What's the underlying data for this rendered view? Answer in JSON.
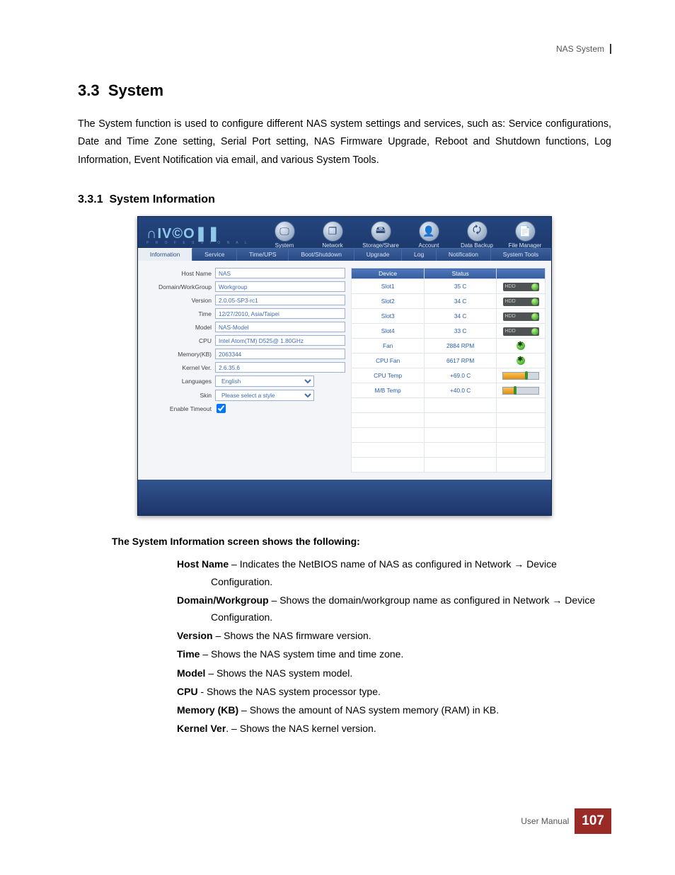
{
  "header": {
    "doc_title": "NAS System"
  },
  "section": {
    "number": "3.3",
    "title": "System"
  },
  "intro": "The System function is used to configure different NAS system settings and services, such as: Service configurations, Date and Time Zone setting, Serial Port setting, NAS Firmware Upgrade, Reboot and Shutdown functions, Log Information, Event Notification via email, and various System Tools.",
  "subsection": {
    "number": "3.3.1",
    "title": "System Information"
  },
  "ui": {
    "logo_main": "∩IV©O❚❚",
    "logo_sub": "P R O F E S S I O N A L",
    "nav_items": [
      {
        "name": "system",
        "label": "System",
        "glyph": "🖵"
      },
      {
        "name": "network",
        "label": "Network",
        "glyph": "❐"
      },
      {
        "name": "storage",
        "label": "Storage/Share",
        "glyph": "🖴"
      },
      {
        "name": "account",
        "label": "Account",
        "glyph": "👤"
      },
      {
        "name": "backup",
        "label": "Data Backup",
        "glyph": "🗘"
      },
      {
        "name": "filemgr",
        "label": "File Manager",
        "glyph": "📄"
      }
    ],
    "tabs": [
      {
        "name": "information",
        "label": "Information",
        "active": true
      },
      {
        "name": "service",
        "label": "Service"
      },
      {
        "name": "timeups",
        "label": "Time/UPS"
      },
      {
        "name": "bootshutdown",
        "label": "Boot/Shutdown"
      },
      {
        "name": "upgrade",
        "label": "Upgrade"
      },
      {
        "name": "log",
        "label": "Log"
      },
      {
        "name": "notification",
        "label": "Notification"
      },
      {
        "name": "systemtools",
        "label": "System Tools"
      }
    ],
    "form": {
      "hostname_label": "Host Name",
      "hostname": "NAS",
      "domain_label": "Domain/WorkGroup",
      "domain": "Workgroup",
      "version_label": "Version",
      "version": "2.0.05-SP3-rc1",
      "time_label": "Time",
      "time": "12/27/2010, Asia/Taipei",
      "model_label": "Model",
      "model": "NAS-Model",
      "cpu_label": "CPU",
      "cpu": "Intel Atom(TM) D525@ 1.80GHz",
      "memory_label": "Memory(KB)",
      "memory": "2063344",
      "kernel_label": "Kernel Ver.",
      "kernel": "2.6.35.6",
      "languages_label": "Languages",
      "languages": "English",
      "skin_label": "Skin",
      "skin": "Please select a style",
      "timeout_label": "Enable Timeout"
    },
    "status": {
      "head_device": "Device",
      "head_status": "Status",
      "head_icon": "",
      "rows": [
        {
          "device": "Slot1",
          "status": "35 C",
          "kind": "hdd",
          "pill": "HDD"
        },
        {
          "device": "Slot2",
          "status": "34 C",
          "kind": "hdd",
          "pill": "HDD"
        },
        {
          "device": "Slot3",
          "status": "34 C",
          "kind": "hdd",
          "pill": "HDD"
        },
        {
          "device": "Slot4",
          "status": "33 C",
          "kind": "hdd",
          "pill": "HDD"
        },
        {
          "device": "Fan",
          "status": "2884 RPM",
          "kind": "fan"
        },
        {
          "device": "CPU Fan",
          "status": "6617 RPM",
          "kind": "fan"
        },
        {
          "device": "CPU Temp",
          "status": "+69.0 C",
          "kind": "bar",
          "fill": 62,
          "marker": 62
        },
        {
          "device": "M/B Temp",
          "status": "+40.0 C",
          "kind": "bar",
          "fill": 30,
          "marker": 30
        }
      ]
    }
  },
  "desc_heading": "The System Information screen shows the following:",
  "desc_items": [
    {
      "term": "Host Name",
      "sep": " – ",
      "text": "Indicates the NetBIOS name of NAS as configured in Network → Device Configuration."
    },
    {
      "term": "Domain/Workgroup",
      "sep": " – ",
      "text": "Shows the domain/workgroup name as configured in Network → Device Configuration."
    },
    {
      "term": "Version",
      "sep": " – ",
      "text": "Shows the NAS firmware version."
    },
    {
      "term": "Time",
      "sep": " – ",
      "text": "Shows the NAS system time and time zone."
    },
    {
      "term": "Model",
      "sep": " – ",
      "text": "Shows the NAS system model."
    },
    {
      "term": "CPU",
      "sep": " - ",
      "text": "Shows the NAS system processor type."
    },
    {
      "term": "Memory (KB)",
      "sep": " – ",
      "text": "Shows the amount of NAS system memory (RAM) in KB."
    },
    {
      "term": "Kernel Ver",
      "sep": ". – ",
      "text": "Shows the NAS kernel version."
    }
  ],
  "footer": {
    "label": "User Manual",
    "page": "107"
  }
}
